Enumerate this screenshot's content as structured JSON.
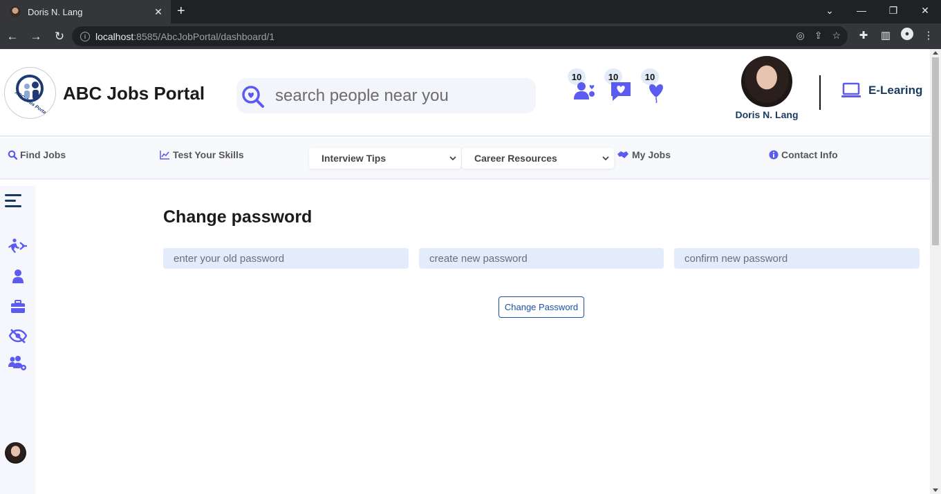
{
  "browser": {
    "tab_title": "Doris N. Lang",
    "url_host": "localhost",
    "url_path": ":8585/AbcJobPortal/dashboard/1"
  },
  "header": {
    "logo_text": "ABC Jobs Portal",
    "brand": "ABC Jobs Portal",
    "search_placeholder": "search people near you",
    "notifications": [
      {
        "count": "10",
        "icon": "people-heart-icon"
      },
      {
        "count": "10",
        "icon": "message-heart-icon"
      },
      {
        "count": "10",
        "icon": "heart-balloon-icon"
      }
    ],
    "user_name": "Doris N. Lang",
    "elearning_label": "E-Learing"
  },
  "navbar": {
    "find_jobs": "Find Jobs",
    "test_skills": "Test Your Skills",
    "interview_tips": "Interview Tips",
    "career_resources": "Career Resources",
    "my_jobs": "My Jobs",
    "contact_info": "Contact Info"
  },
  "main": {
    "title": "Change password",
    "old_password_placeholder": "enter your old password",
    "new_password_placeholder": "create new password",
    "confirm_password_placeholder": "confirm new password",
    "submit_label": "Change Password"
  },
  "colors": {
    "accent": "#5b5bf0",
    "input_bg": "#e3ecfb",
    "button_border": "#1e4fa8"
  }
}
